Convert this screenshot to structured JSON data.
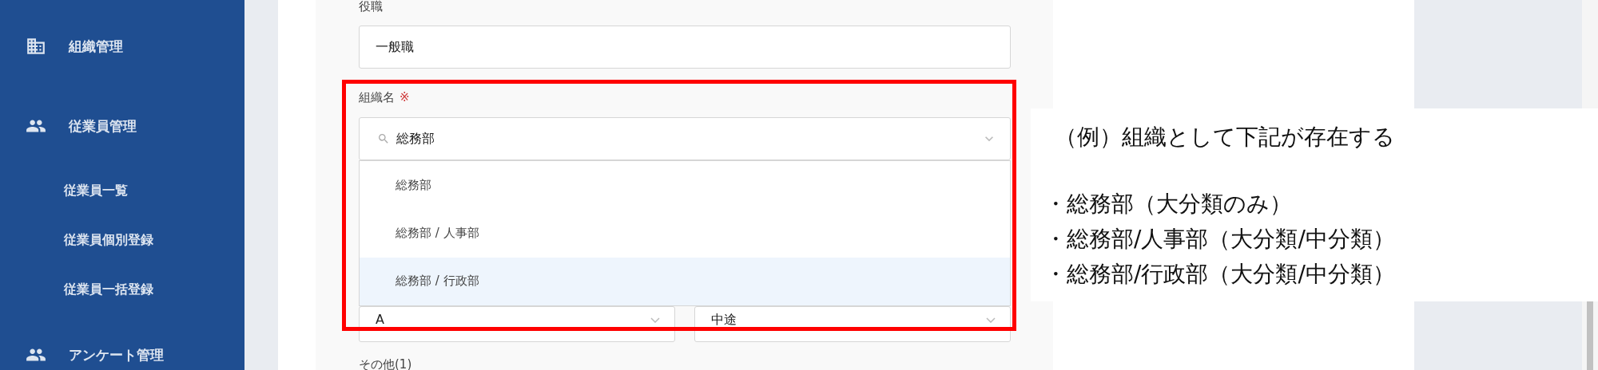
{
  "sidebar": {
    "items": [
      {
        "label": "組織管理",
        "kind": "building"
      },
      {
        "label": "従業員管理",
        "kind": "people",
        "children": [
          {
            "label": "従業員一覧"
          },
          {
            "label": "従業員個別登録"
          },
          {
            "label": "従業員一括登録"
          }
        ]
      },
      {
        "label": "アンケート管理",
        "kind": "people"
      }
    ]
  },
  "form": {
    "position": {
      "label": "役職",
      "value": "一般職"
    },
    "organization": {
      "label": "組織名",
      "required_mark": "※",
      "query": "総務部",
      "options": [
        {
          "label": "総務部",
          "selected": false
        },
        {
          "label": "総務部 / 人事部",
          "selected": false
        },
        {
          "label": "総務部 / 行政部",
          "selected": true
        }
      ]
    },
    "selects": [
      {
        "value": "A"
      },
      {
        "value": "中途"
      }
    ],
    "next_label": "その他(1)"
  },
  "annotation": {
    "title": "（例）組織として下記が存在する",
    "lines": [
      "・総務部（大分類のみ）",
      "・総務部/人事部（大分類/中分類）",
      "・総務部/行政部（大分類/中分類）"
    ]
  }
}
